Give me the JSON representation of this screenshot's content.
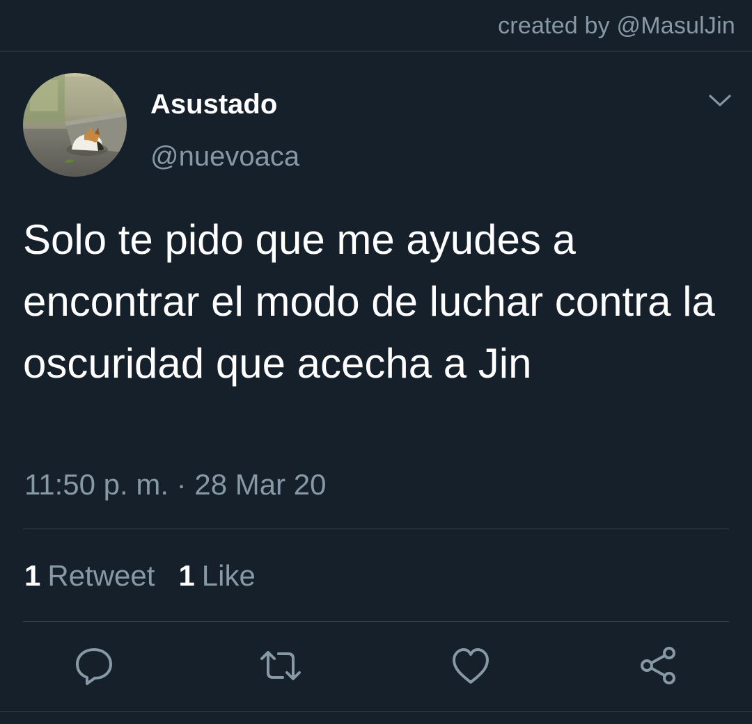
{
  "credit": "created by @MasulJin",
  "tweet": {
    "display_name": "Asustado",
    "handle": "@nuevoaca",
    "text": "Solo te pido que me ayudes a encontrar el modo de luchar contra la oscuridad que acecha a Jin",
    "timestamp": "11:50 p. m. · 28 Mar 20",
    "stats": {
      "retweets_count": "1",
      "retweets_label": "Retweet",
      "likes_count": "1",
      "likes_label": "Like"
    }
  },
  "icons": {
    "menu": "chevron-down-icon",
    "reply": "reply-icon",
    "retweet": "retweet-icon",
    "like": "heart-icon",
    "share": "share-icon"
  },
  "colors": {
    "background": "#15202b",
    "secondary_text": "#8899a6",
    "border": "#38444d",
    "primary_text": "#ffffff"
  }
}
